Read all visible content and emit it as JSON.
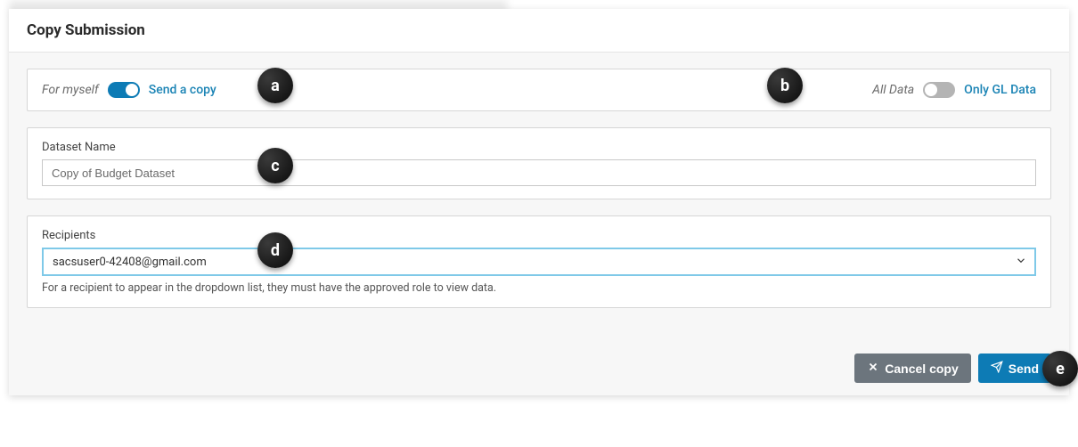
{
  "header": {
    "title": "Copy Submission"
  },
  "toggles": {
    "copy_mode": {
      "off_label": "For myself",
      "on_label": "Send a copy",
      "on": true
    },
    "data_scope": {
      "off_label": "All Data",
      "on_label": "Only GL Data",
      "on": false
    }
  },
  "dataset": {
    "label": "Dataset Name",
    "value": "Copy of Budget Dataset"
  },
  "recipients": {
    "label": "Recipients",
    "selected": "sacsuser0-42408@gmail.com",
    "help": "For a recipient to appear in the dropdown list, they must have the approved role to view data."
  },
  "buttons": {
    "cancel": "Cancel copy",
    "send": "Send"
  },
  "annotations": {
    "a": "a",
    "b": "b",
    "c": "c",
    "d": "d",
    "e": "e"
  }
}
